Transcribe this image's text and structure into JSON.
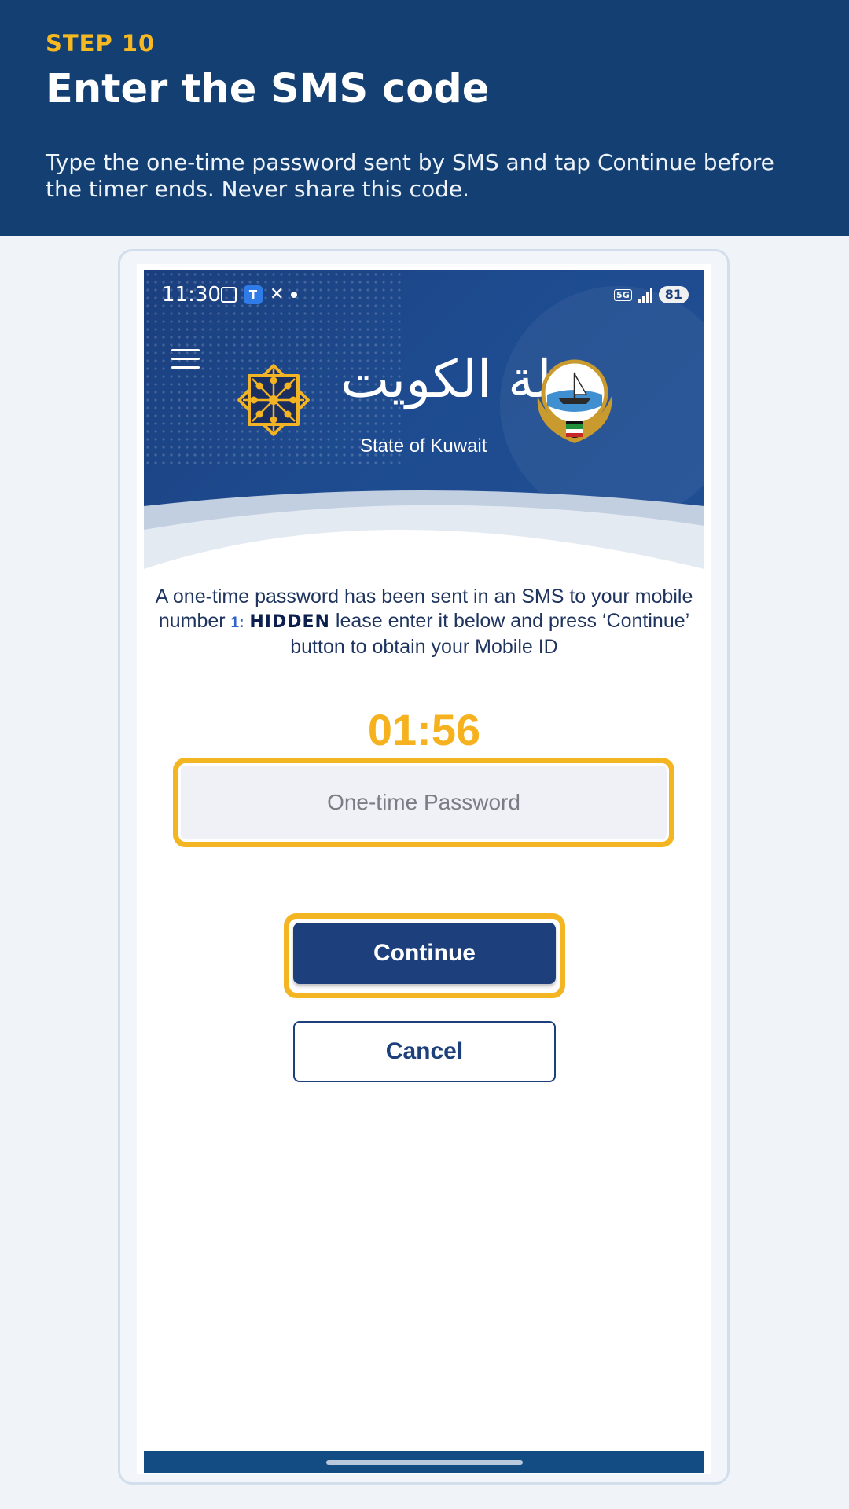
{
  "header": {
    "step": "STEP 10",
    "title": "Enter the SMS code",
    "instruction": "Type the one-time password sent by SMS and tap Continue before the timer ends. Never share this code."
  },
  "status_bar": {
    "time": "11:30",
    "network": "5G",
    "battery": "81",
    "icons": [
      "screenshot-icon",
      "app-icon",
      "x-icon",
      "dot-icon",
      "signal-icon",
      "battery-icon"
    ]
  },
  "app": {
    "brand_arabic": "دولة الكويت",
    "brand_english": "State of Kuwait",
    "message_part1": "A one-time password has been sent in an SMS to your mobile number",
    "hidden_number_prefix": "1:",
    "hidden_label": "HIDDEN",
    "message_part2": "lease enter it below and press ‘Continue’ button to obtain your Mobile ID",
    "timer": "01:56",
    "otp_placeholder": "One-time Password",
    "continue_label": "Continue",
    "cancel_label": "Cancel"
  },
  "colors": {
    "banner": "#133f72",
    "accent": "#f6b922",
    "primary_button": "#1d3f7b",
    "timer": "#f5b21e"
  }
}
